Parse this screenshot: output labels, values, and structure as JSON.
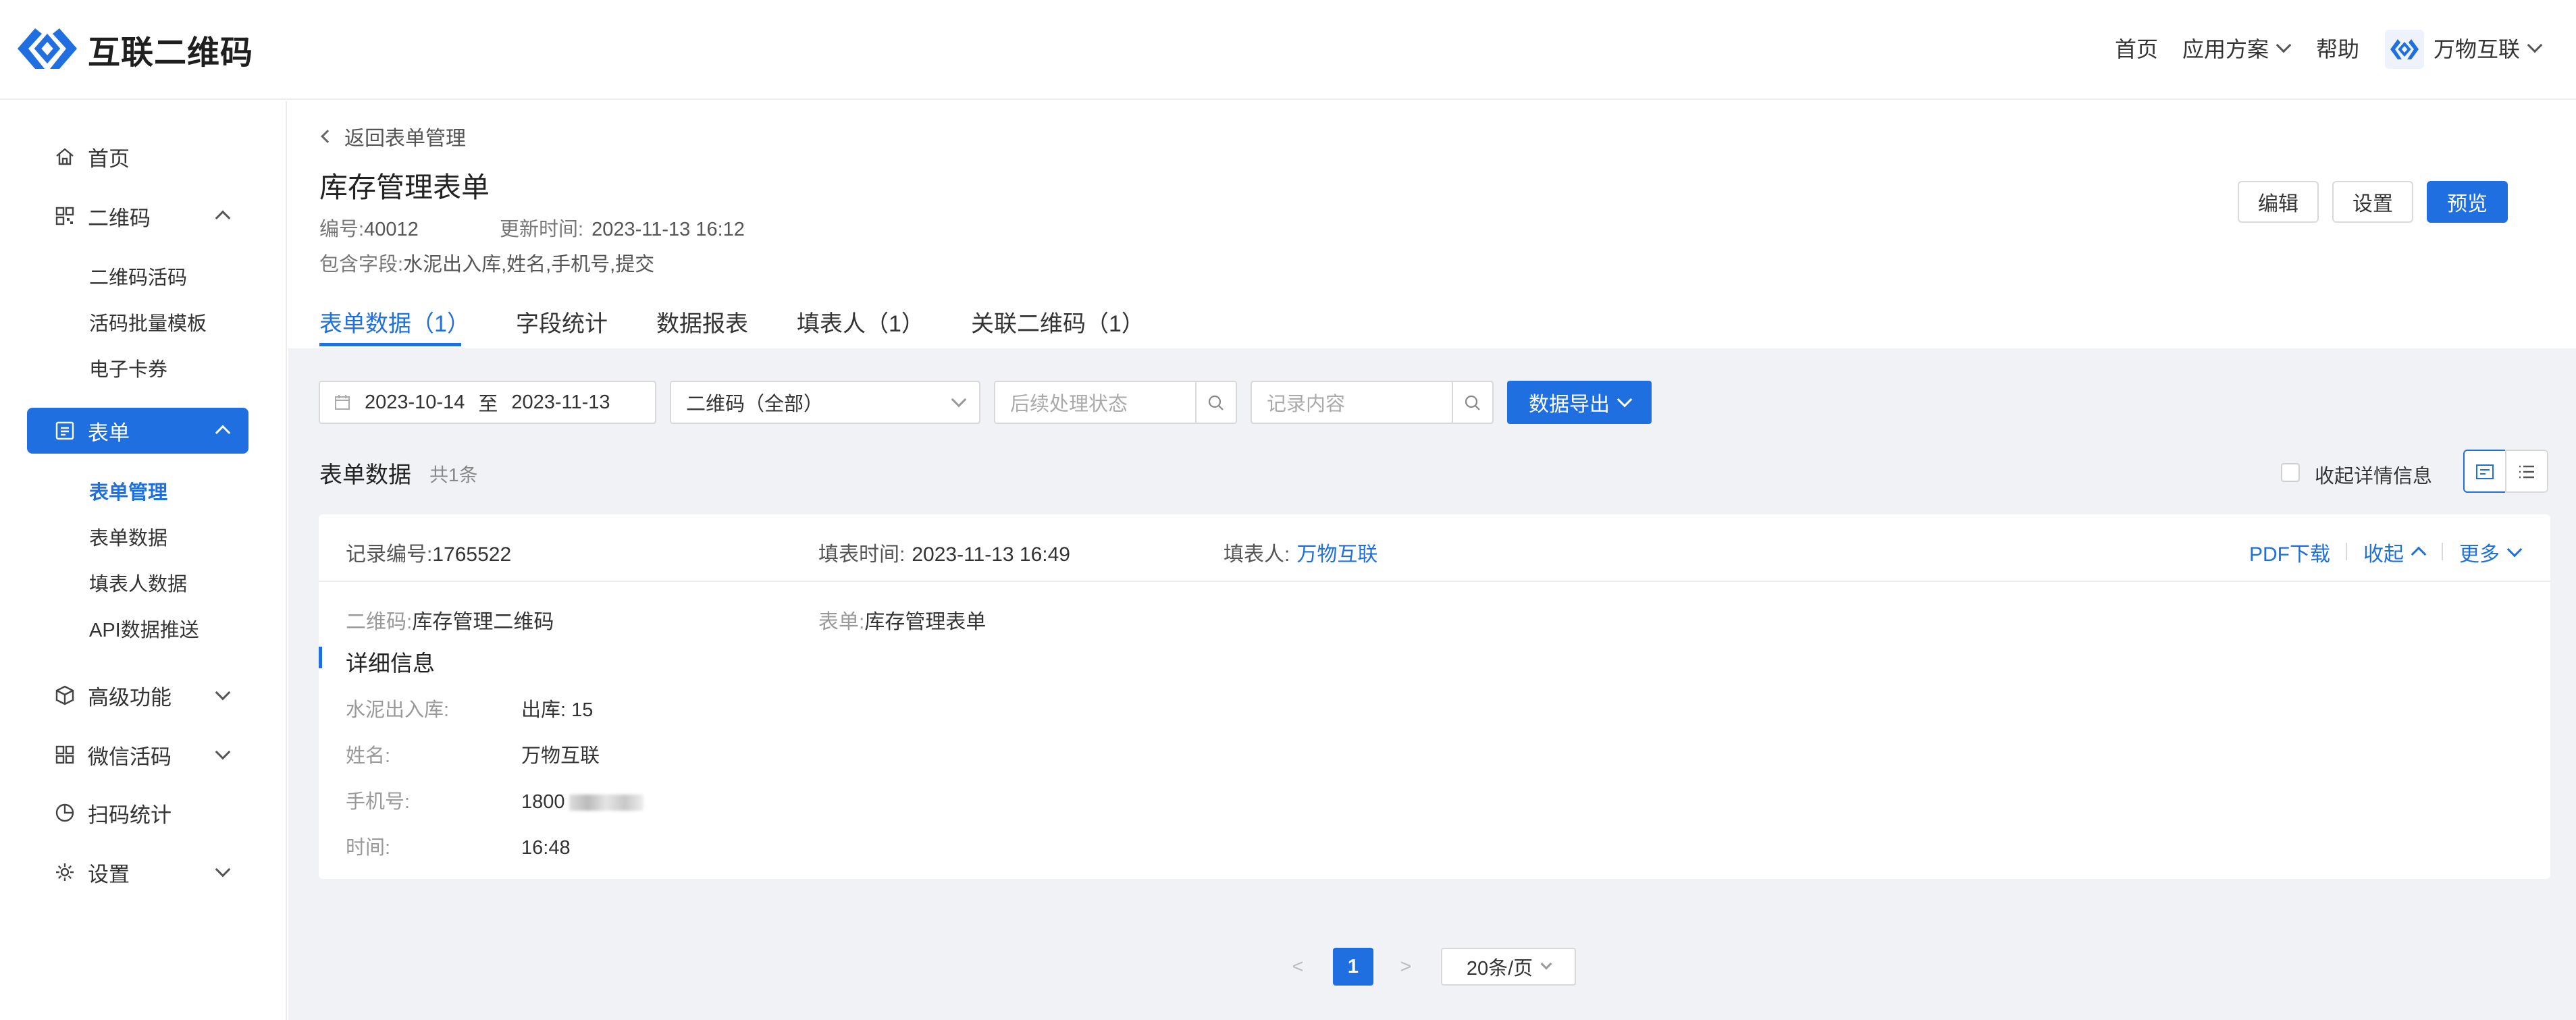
{
  "header": {
    "brand": "互联二维码",
    "nav": [
      "首页",
      "应用方案",
      "帮助"
    ],
    "user": "万物互联"
  },
  "sidebar": {
    "home": "首页",
    "qrcode": "二维码",
    "qrcode_subs": [
      "二维码活码",
      "活码批量模板",
      "电子卡券"
    ],
    "form": "表单",
    "form_subs": [
      "表单管理",
      "表单数据",
      "填表人数据",
      "API数据推送"
    ],
    "advanced": "高级功能",
    "wechat": "微信活码",
    "scan_stats": "扫码统计",
    "settings": "设置"
  },
  "page": {
    "back": "返回表单管理",
    "title": "库存管理表单",
    "id_label": "编号:",
    "id_value": "40012",
    "updated_label": "更新时间:",
    "updated_value": "2023-11-13 16:12",
    "fields_label": "包含字段:",
    "fields_value": "水泥出入库,姓名,手机号,提交",
    "buttons": {
      "edit": "编辑",
      "settings": "设置",
      "preview": "预览"
    },
    "tabs": [
      "表单数据（1）",
      "字段统计",
      "数据报表",
      "填表人（1）",
      "关联二维码（1）"
    ]
  },
  "filters": {
    "date_from": "2023-10-14",
    "date_sep": "至",
    "date_to": "2023-11-13",
    "qrcode_select": "二维码（全部）",
    "status_placeholder": "后续处理状态",
    "content_placeholder": "记录内容",
    "export": "数据导出"
  },
  "list": {
    "title": "表单数据",
    "count": "共1条",
    "collapse_details": "收起详情信息"
  },
  "record": {
    "no_label": "记录编号:",
    "no_value": "1765522",
    "time_label": "填表时间:",
    "time_value": "2023-11-13 16:49",
    "filler_label": "填表人:",
    "filler_value": "万物互联",
    "pdf": "PDF下载",
    "collapse": "收起",
    "more": "更多",
    "qrcode_label": "二维码:",
    "qrcode_value": "库存管理二维码",
    "form_label": "表单:",
    "form_value": "库存管理表单",
    "detail_title": "详细信息",
    "details": [
      {
        "k": "水泥出入库:",
        "v": "出库:  15"
      },
      {
        "k": "姓名:",
        "v": "万物互联"
      },
      {
        "k": "手机号:",
        "v": "1800"
      },
      {
        "k": "时间:",
        "v": "16:48"
      }
    ]
  },
  "pagination": {
    "prev": "<",
    "current": "1",
    "next": ">",
    "page_size": "20条/页"
  },
  "colors": {
    "accent": "#1f6fe0",
    "background": "#f0f2f5"
  }
}
